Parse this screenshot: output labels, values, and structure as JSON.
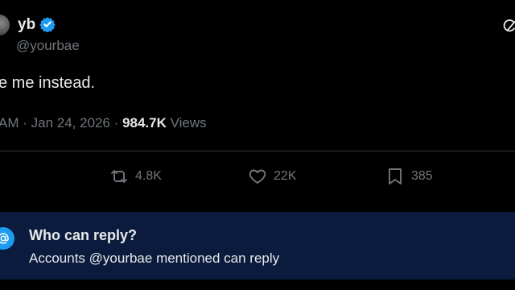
{
  "author": {
    "name": "yb",
    "handle": "@yourbae"
  },
  "tweet": {
    "text": "e me instead.",
    "time": "AM",
    "date": "Jan 24, 2026",
    "views_count": "984.7K",
    "views_label": "Views"
  },
  "actions": {
    "retweets": "4.8K",
    "likes": "22K",
    "bookmarks": "385"
  },
  "reply_banner": {
    "title": "Who can reply?",
    "subtitle": "Accounts @yourbae mentioned can reply"
  },
  "colors": {
    "background": "#000000",
    "text": "#e7e9ea",
    "muted": "#71767b",
    "accent": "#1d9bf0",
    "banner": "#0a1b3d"
  },
  "icons": [
    "verified-badge-icon",
    "grok-icon",
    "retweet-icon",
    "heart-icon",
    "bookmark-icon",
    "at-sign-icon"
  ]
}
